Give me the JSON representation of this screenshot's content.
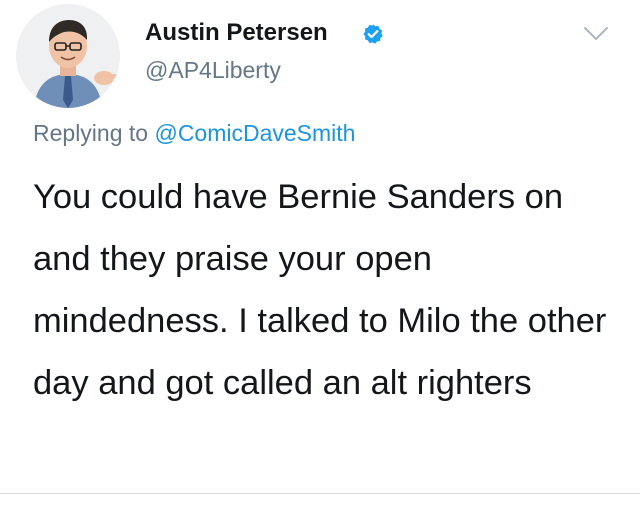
{
  "tweet": {
    "author": {
      "display_name": "Austin Petersen",
      "handle": "@AP4Liberty",
      "verified": true,
      "avatar_icon": "user-avatar"
    },
    "menu_icon": "chevron-down-icon",
    "reply": {
      "prefix": "Replying to",
      "mention": "@ComicDaveSmith"
    },
    "text": "You could have Bernie Sanders on and they praise your open mindedness. I talked to Milo the other day and got called an alt righters"
  },
  "colors": {
    "verified": "#1da1f2",
    "link": "#1b95e0",
    "secondary_text": "#657786",
    "primary_text": "#14171a"
  }
}
